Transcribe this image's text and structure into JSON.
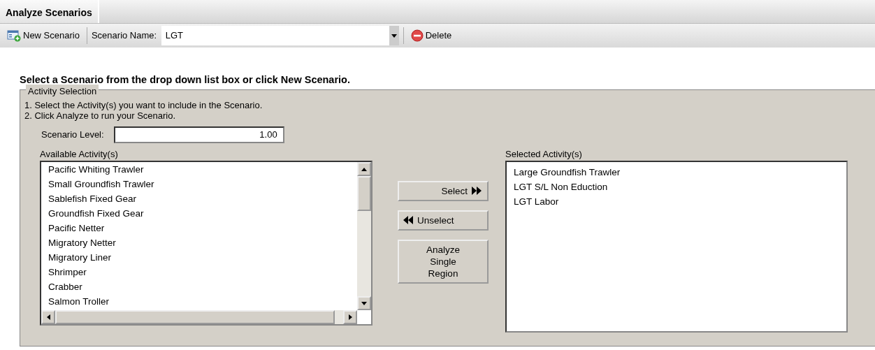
{
  "tab": {
    "label": "Analyze Scenarios",
    "selected": true
  },
  "toolbar": {
    "new_button": "New Scenario",
    "name_label": "Scenario Name:",
    "name_value": "LGT",
    "delete_button": "Delete"
  },
  "heading": "Select a Scenario from the drop down list box or click New Scenario.",
  "group": {
    "legend": "Activity Selection",
    "instructions": [
      "1. Select the Activity(s) you want to include in the Scenario.",
      "2. Click Analyze to run your Scenario."
    ],
    "level_label": "Scenario Level:",
    "level_value": "1.00",
    "available_label": "Available Activity(s)",
    "available": [
      "Pacific Whiting Trawler",
      "Small Groundfish Trawler",
      "Sablefish Fixed Gear",
      "Groundfish Fixed Gear",
      "Pacific Netter",
      "Migratory Netter",
      "Migratory Liner",
      "Shrimper",
      "Crabber",
      "Salmon Troller"
    ],
    "buttons": [
      {
        "kind": "forward",
        "label": "Select"
      },
      {
        "kind": "back",
        "label": "Unselect"
      },
      {
        "kind": "plain",
        "label": "Analyze Single Region"
      }
    ],
    "selected_label": "Selected Activity(s)",
    "selected": [
      "Large Groundfish Trawler",
      "LGT S/L Non Eduction",
      "LGT Labor"
    ]
  }
}
